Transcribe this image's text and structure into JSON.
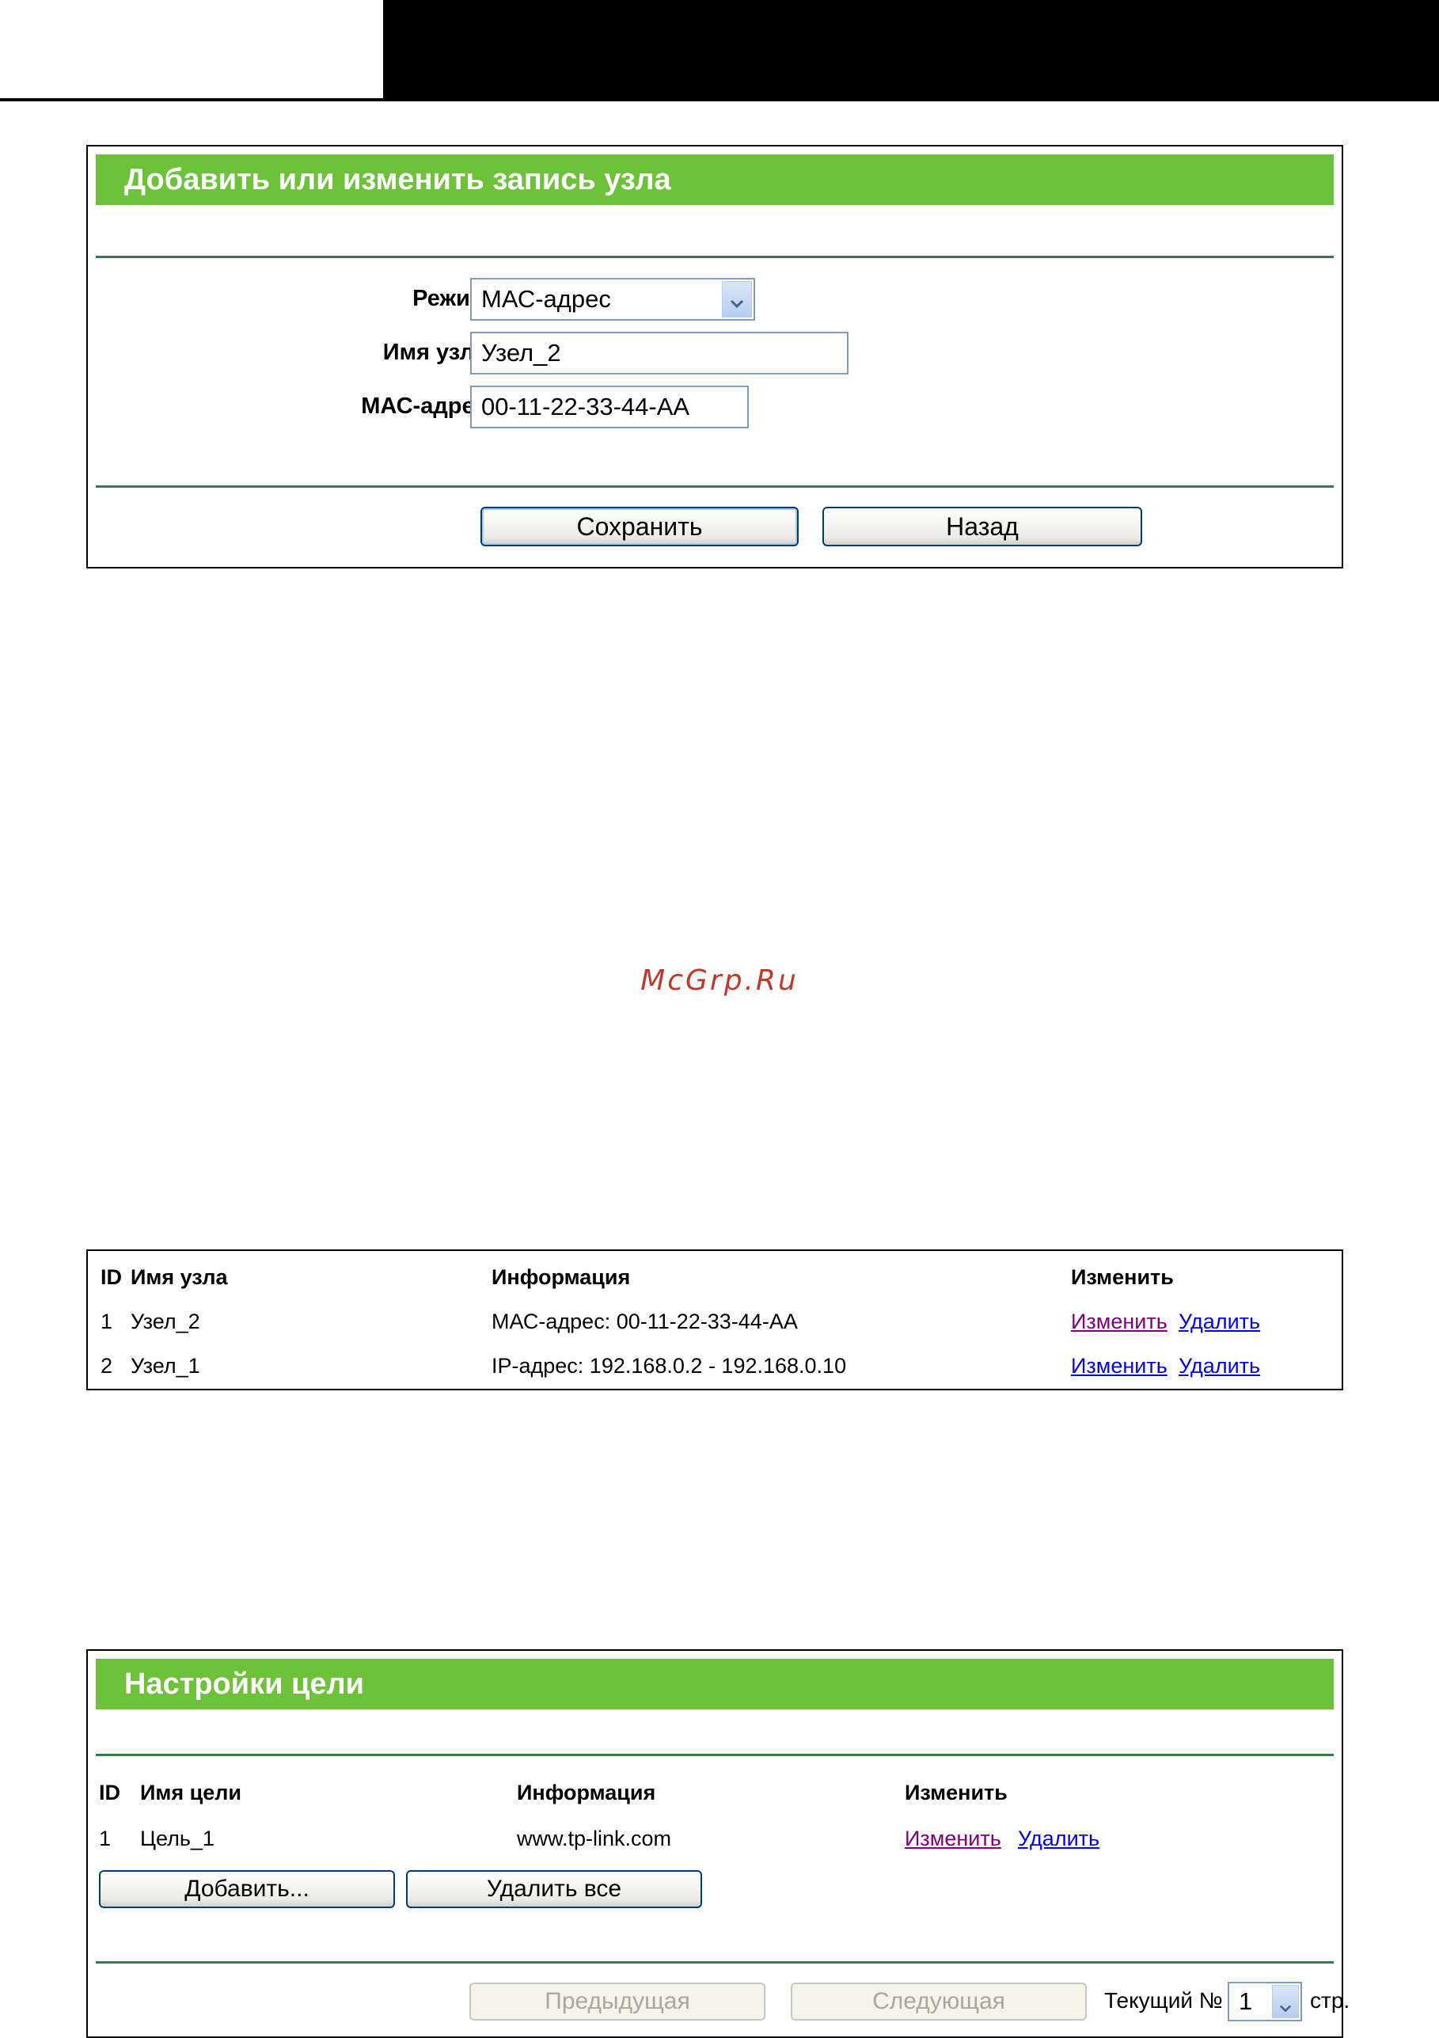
{
  "host_form": {
    "title": "Добавить или изменить запись узла",
    "mode_label": "Режим:",
    "mode_value": "МАС-адрес",
    "host_name_label": "Имя узла:",
    "host_name_value": "Узел_2",
    "mac_label": "МАС-адрес:",
    "mac_value": "00-11-22-33-44-AA",
    "save_button": "Сохранить",
    "back_button": "Назад"
  },
  "watermark": "McGrp.Ru",
  "host_table": {
    "headers": {
      "id": "ID",
      "name": "Имя узла",
      "info": "Информация",
      "modify": "Изменить"
    },
    "rows": [
      {
        "id": "1",
        "name": "Узел_2",
        "info": "МАС-адрес: 00-11-22-33-44-АА",
        "edit": "Изменить",
        "delete": "Удалить"
      },
      {
        "id": "2",
        "name": "Узел_1",
        "info": "IP-адрес: 192.168.0.2 - 192.168.0.10",
        "edit": "Изменить",
        "delete": "Удалить"
      }
    ]
  },
  "target_panel": {
    "title": "Настройки цели",
    "headers": {
      "id": "ID",
      "name": "Имя цели",
      "info": "Информация",
      "modify": "Изменить"
    },
    "rows": [
      {
        "id": "1",
        "name": "Цель_1",
        "info": "www.tp-link.com",
        "edit": "Изменить",
        "delete": "Удалить"
      }
    ],
    "add_button": "Добавить...",
    "delete_all_button": "Удалить все",
    "prev_button": "Предыдущая",
    "next_button": "Следующая",
    "current_page_label": "Текущий №",
    "current_page_value": "1",
    "page_suffix": "стр."
  },
  "icons": {
    "dropdown": "chevron-down-icon"
  },
  "colors": {
    "header_green": "#6ec23a",
    "divider_green": "#2e7d4f",
    "link_blue": "#0000ee",
    "link_visited": "#800080"
  }
}
